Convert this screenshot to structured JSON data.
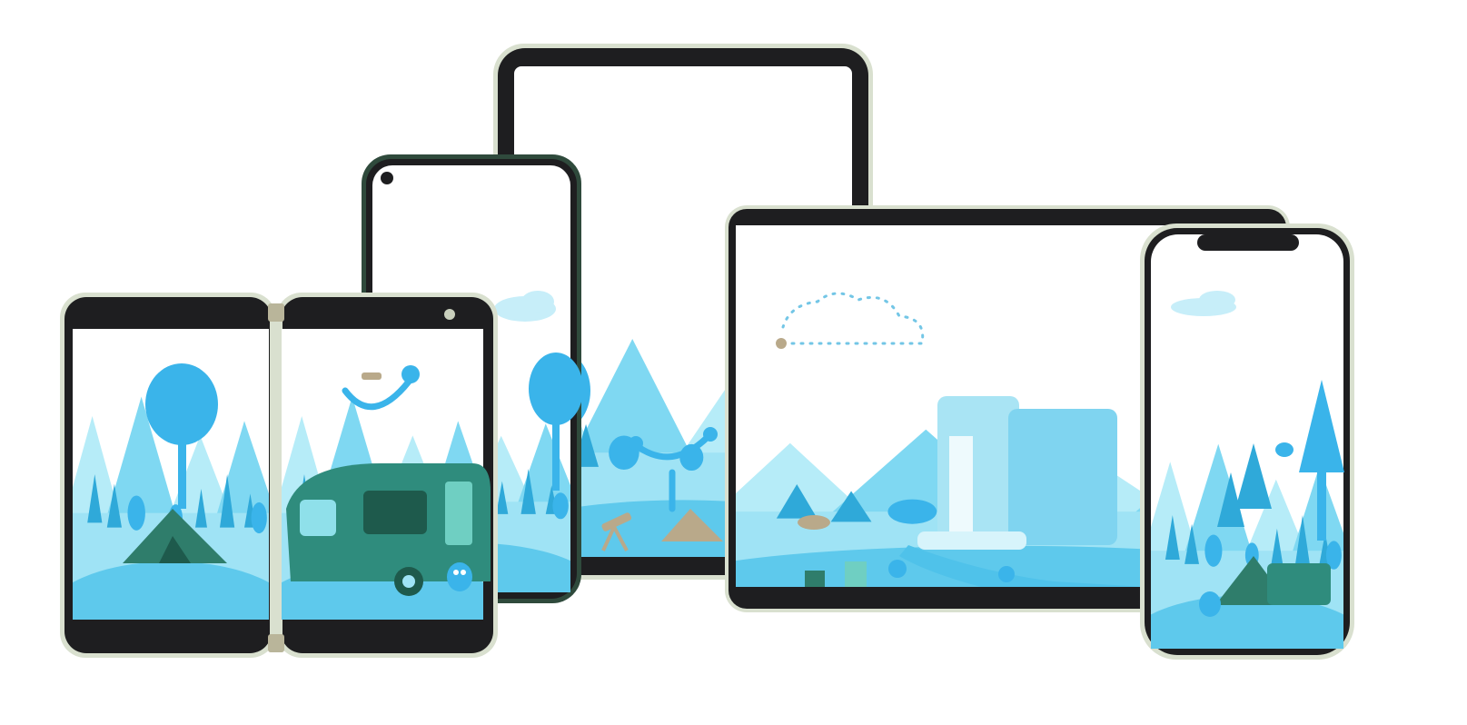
{
  "scene": {
    "kind": "device-lineup",
    "devices": [
      "foldable-dual-screen",
      "android-phone",
      "tablet-portrait",
      "tablet-landscape",
      "iphone"
    ],
    "illustration_theme": "camping-landscape"
  },
  "colors": {
    "background": "#ffffff",
    "bezel": "#1e1e20",
    "frame_sage": "#d9e0cf",
    "frame_green": "#2f4a3c",
    "sky": "#ffffff",
    "ground": "#9fe3f5",
    "ground_dark": "#5ec9ec",
    "tree": "#3ab4ea",
    "tree_light": "#6fd0f0",
    "mountain": "#7fd8f2",
    "mountain_light": "#b6ecf8",
    "tent": "#2f7d6b",
    "trailer": "#2f8c7d",
    "water": "#4fc2ea",
    "cloud": "#c7eef9",
    "dots": "#73c6e6",
    "tan": "#b9a98a"
  }
}
